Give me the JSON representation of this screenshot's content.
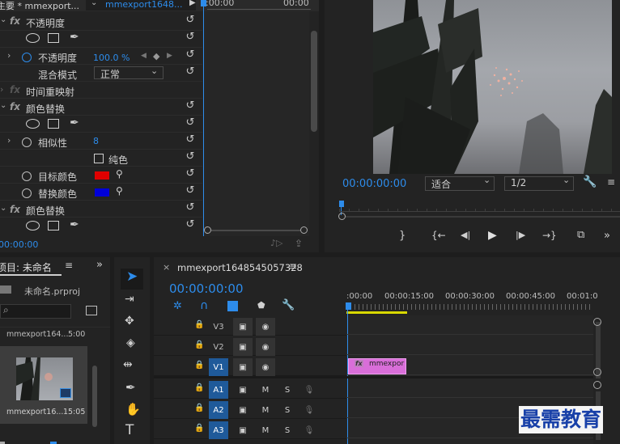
{
  "effect_controls": {
    "source_label": "主要 * mmexport...",
    "clip_name": "mmexport1648...",
    "ruler_start": ":00:00",
    "ruler_end": "00:00",
    "opacity_group": "不透明度",
    "opacity_label": "不透明度",
    "opacity_value": "100.0 %",
    "blend_label": "混合模式",
    "blend_value": "正常",
    "time_remap": "时间重映射",
    "color_replace_1": "颜色替换",
    "similarity_label": "相似性",
    "similarity_value": "8",
    "pure_color_label": "纯色",
    "target_color_label": "目标颜色",
    "replace_color_label": "替换颜色",
    "color_replace_2": "颜色替换",
    "timecode": "00:00:00",
    "target_color": "#e00000",
    "replace_color": "#0000d8"
  },
  "program_monitor": {
    "timecode": "00:00:00:00",
    "fit_value": "适合",
    "resolution_value": "1/2"
  },
  "project": {
    "tab_label": "项目: 未命名",
    "project_file": "未命名.prproj",
    "clip_name": "mmexport164...",
    "clip_duration": "5:00",
    "thumb_name": "mmexport16...",
    "thumb_duration": "15:05"
  },
  "timeline": {
    "sequence_name": "mmexport1648545057328",
    "timecode": "00:00:00:00",
    "ruler_labels": [
      ":00:00",
      "00:00:15:00",
      "00:00:30:00",
      "00:00:45:00",
      "00:01:0"
    ],
    "video_tracks": [
      "V3",
      "V2",
      "V1"
    ],
    "audio_tracks": [
      "A1",
      "A2",
      "A3"
    ],
    "mute_label": "M",
    "solo_label": "S",
    "clip_label": "mmexpor"
  },
  "watermark": "最需教育"
}
